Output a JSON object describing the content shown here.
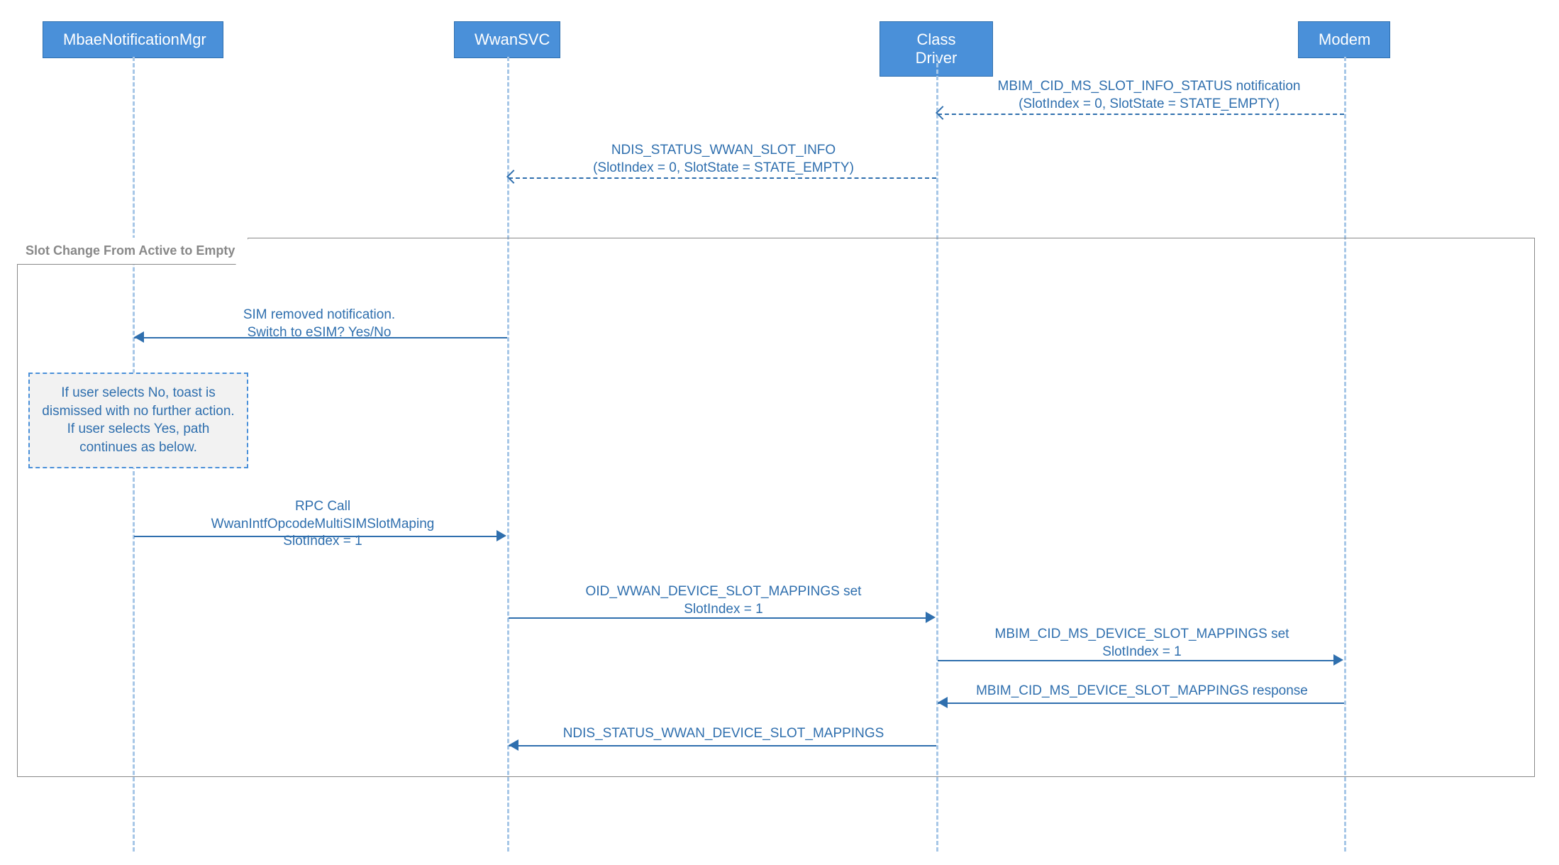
{
  "participants": {
    "mbae": "MbaeNotificationMgr",
    "wwansvc": "WwanSVC",
    "classdrv": "Class Driver",
    "modem": "Modem"
  },
  "frame": {
    "label": "Slot Change From Active to Empty"
  },
  "note": {
    "text": "If user selects No, toast is dismissed with no further action. If user selects Yes, path continues as below."
  },
  "messages": {
    "m1": {
      "line1": "MBIM_CID_MS_SLOT_INFO_STATUS notification",
      "line2": "(SlotIndex = 0, SlotState = STATE_EMPTY)"
    },
    "m2": {
      "line1": "NDIS_STATUS_WWAN_SLOT_INFO",
      "line2": "(SlotIndex = 0, SlotState = STATE_EMPTY)"
    },
    "m3": {
      "line1": "SIM removed notification.",
      "line2": "Switch to eSIM? Yes/No"
    },
    "m4": {
      "line1": "RPC Call",
      "line2": "WwanIntfOpcodeMultiSIMSlotMaping",
      "line3": "SlotIndex = 1"
    },
    "m5": {
      "line1": "OID_WWAN_DEVICE_SLOT_MAPPINGS set",
      "line2": "SlotIndex = 1"
    },
    "m6": {
      "line1": "MBIM_CID_MS_DEVICE_SLOT_MAPPINGS set",
      "line2": "SlotIndex = 1"
    },
    "m7": {
      "line1": "MBIM_CID_MS_DEVICE_SLOT_MAPPINGS response"
    },
    "m8": {
      "line1": "NDIS_STATUS_WWAN_DEVICE_SLOT_MAPPINGS"
    }
  }
}
